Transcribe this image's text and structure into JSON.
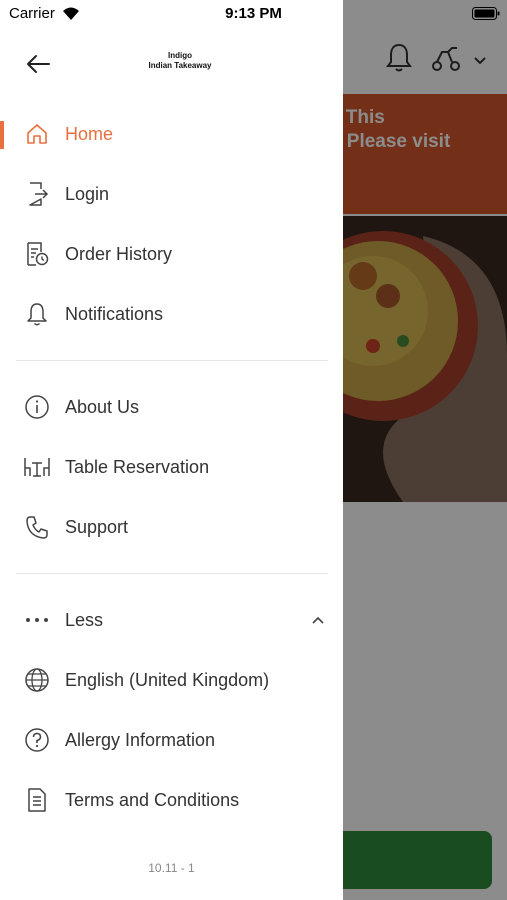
{
  "status_bar": {
    "carrier": "Carrier",
    "time": "9:13 PM"
  },
  "header": {
    "logo_line1": "Indigo",
    "logo_line2": "Indian Takeaway"
  },
  "background": {
    "banner_text": "ed, This\non. Please visit"
  },
  "menu": {
    "primary": [
      {
        "label": "Home",
        "icon": "home-icon",
        "active": true
      },
      {
        "label": "Login",
        "icon": "login-icon"
      },
      {
        "label": "Order History",
        "icon": "order-history-icon"
      },
      {
        "label": "Notifications",
        "icon": "bell-icon"
      }
    ],
    "secondary": [
      {
        "label": "About Us",
        "icon": "info-icon"
      },
      {
        "label": "Table Reservation",
        "icon": "table-icon"
      },
      {
        "label": "Support",
        "icon": "phone-icon"
      }
    ],
    "more": [
      {
        "label": "Less",
        "icon": "more-dots-icon"
      },
      {
        "label": "English (United Kingdom)",
        "icon": "globe-icon"
      },
      {
        "label": "Allergy Information",
        "icon": "question-icon"
      },
      {
        "label": "Terms and Conditions",
        "icon": "document-icon"
      }
    ]
  },
  "footer": {
    "version": "10.11 - 1"
  },
  "colors": {
    "accent": "#e8703f",
    "text": "#333333",
    "banner": "#d2562a",
    "button_green": "#2e8a37"
  }
}
